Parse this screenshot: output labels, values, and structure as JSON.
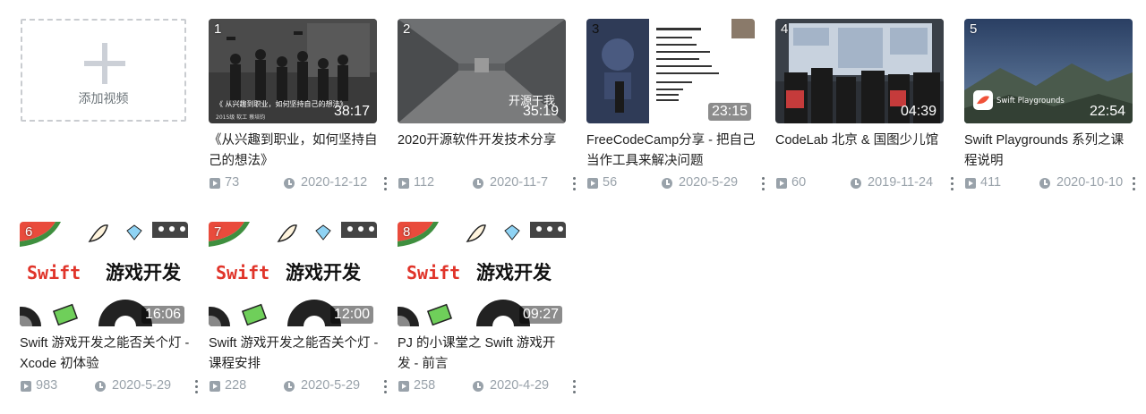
{
  "add_video": {
    "label": "添加视频"
  },
  "videos": [
    {
      "index": "1",
      "duration": "38:17",
      "title": "《从兴趣到职业，如何坚持自己的想法》",
      "plays": "73",
      "date": "2020-12-12",
      "thumb_caption": "《 从兴趣到职业，如何坚持自己的想法》",
      "thumb_sub": "2015级 软工 蔡培钧"
    },
    {
      "index": "2",
      "duration": "35:19",
      "title": "2020开源软件开发技术分享",
      "plays": "112",
      "date": "2020-11-7",
      "thumb_caption": "开源干我"
    },
    {
      "index": "3",
      "duration": "23:15",
      "title": "FreeCodeCamp分享 - 把自己当作工具来解决问题",
      "plays": "56",
      "date": "2020-5-29"
    },
    {
      "index": "4",
      "duration": "04:39",
      "title": "CodeLab 北京 & 国图少儿馆",
      "plays": "60",
      "date": "2019-11-24"
    },
    {
      "index": "5",
      "duration": "22:54",
      "title": "Swift Playgrounds 系列之课程说明",
      "plays": "411",
      "date": "2020-10-10",
      "thumb_caption": "Swift Playgrounds"
    },
    {
      "index": "6",
      "duration": "16:06",
      "title": "Swift 游戏开发之能否关个灯 - Xcode 初体验",
      "plays": "983",
      "date": "2020-5-29",
      "thumb_swift": "Swift",
      "thumb_cn": "游戏开发"
    },
    {
      "index": "7",
      "duration": "12:00",
      "title": "Swift 游戏开发之能否关个灯 - 课程安排",
      "plays": "228",
      "date": "2020-5-29",
      "thumb_swift": "Swift",
      "thumb_cn": "游戏开发"
    },
    {
      "index": "8",
      "duration": "09:27",
      "title": "PJ 的小课堂之 Swift 游戏开发 - 前言",
      "plays": "258",
      "date": "2020-4-29",
      "thumb_swift": "Swift",
      "thumb_cn": "游戏开发"
    }
  ],
  "colors": {
    "text": "#212121",
    "meta": "#99a2aa",
    "dashed_border": "#c9ccd0",
    "plus": "#ccd0d7",
    "swift_red": "#e0342a"
  }
}
